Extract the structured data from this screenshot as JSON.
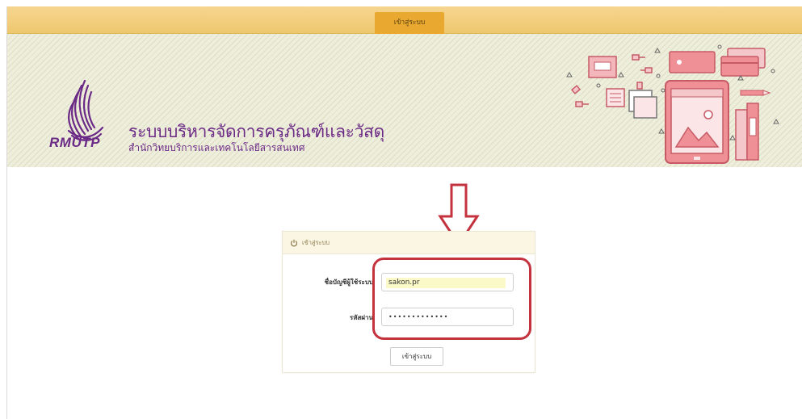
{
  "nav": {
    "login_tab": "เข้าสู่ระบบ"
  },
  "brand": {
    "logo_text": "RMUTP",
    "title": "ระบบบริหารจัดการครุภัณฑ์และวัสดุ",
    "subtitle": "สำนักวิทยบริการและเทคโนโลยีสารสนเทศ",
    "color": "#6b2a86"
  },
  "login": {
    "panel_title": "เข้าสู่ระบบ",
    "username_label": "ชื่อบัญชีผู้ใช้ระบบ",
    "username_value": "sakon.pr",
    "password_label": "รหัสผ่าน",
    "password_value": "•••••••••••••",
    "submit_label": "เข้าสู่ระบบ"
  },
  "colors": {
    "topbar": "#eec86f",
    "tab_active": "#e9a930",
    "banner": "#eeeedc",
    "annotation": "#c4323e"
  },
  "icons": {
    "panel_icon": "power-icon",
    "annotation_arrow": "down-arrow-icon"
  }
}
